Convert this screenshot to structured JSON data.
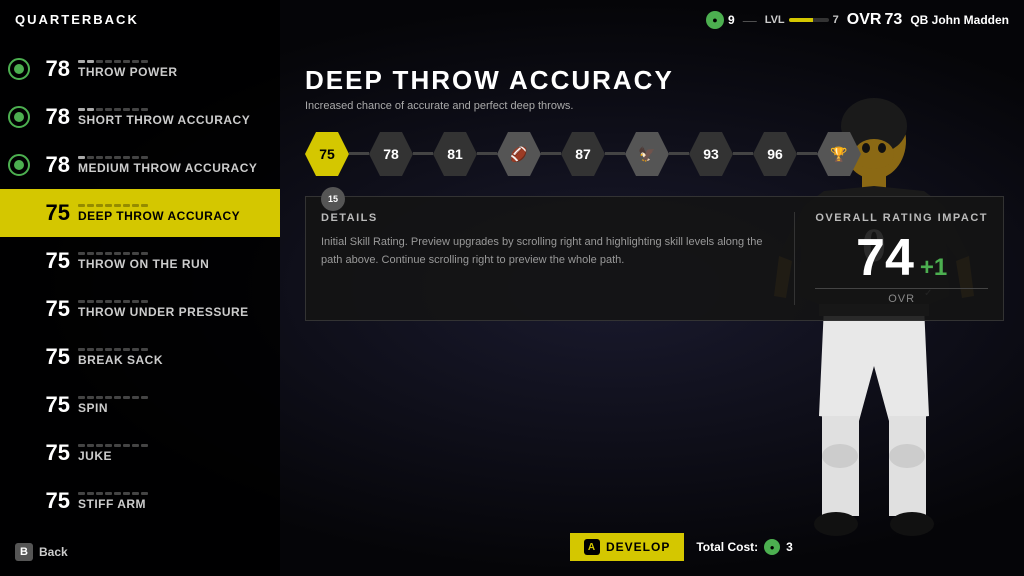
{
  "header": {
    "currency_amount": "9",
    "level_label": "LVL",
    "level_value": "7",
    "ovr_label": "OVR",
    "ovr_value": "73",
    "position_label": "QB",
    "player_name": "John Madden"
  },
  "sidebar": {
    "title": "QUARTERBACK",
    "skills": [
      {
        "id": "throw-power",
        "rating": "78",
        "name": "Throw Power",
        "dots": 8,
        "filled": 2,
        "active": false,
        "has_icon": true
      },
      {
        "id": "short-throw",
        "rating": "78",
        "name": "Short Throw Accuracy",
        "dots": 8,
        "filled": 2,
        "active": false,
        "has_icon": true
      },
      {
        "id": "medium-throw",
        "rating": "78",
        "name": "Medium Throw Accuracy",
        "dots": 8,
        "filled": 1,
        "active": false,
        "has_icon": true
      },
      {
        "id": "deep-throw",
        "rating": "75",
        "name": "Deep Throw Accuracy",
        "dots": 8,
        "filled": 0,
        "active": true,
        "has_icon": false
      },
      {
        "id": "throw-on-run",
        "rating": "75",
        "name": "Throw On The Run",
        "dots": 8,
        "filled": 0,
        "active": false,
        "has_icon": false
      },
      {
        "id": "throw-pressure",
        "rating": "75",
        "name": "Throw Under Pressure",
        "dots": 8,
        "filled": 0,
        "active": false,
        "has_icon": false
      },
      {
        "id": "break-sack",
        "rating": "75",
        "name": "Break Sack",
        "dots": 8,
        "filled": 0,
        "active": false,
        "has_icon": false
      },
      {
        "id": "spin",
        "rating": "75",
        "name": "Spin",
        "dots": 8,
        "filled": 0,
        "active": false,
        "has_icon": false
      },
      {
        "id": "juke",
        "rating": "75",
        "name": "Juke",
        "dots": 8,
        "filled": 0,
        "active": false,
        "has_icon": false
      },
      {
        "id": "stiff-arm",
        "rating": "75",
        "name": "Stiff Arm",
        "dots": 8,
        "filled": 0,
        "active": false,
        "has_icon": false
      }
    ]
  },
  "skill_detail": {
    "title": "DEEP THROW ACCURACY",
    "description": "Increased chance of accurate and perfect deep throws.",
    "upgrade_path": [
      {
        "type": "number",
        "value": "75",
        "current": true
      },
      {
        "type": "number",
        "value": "78"
      },
      {
        "type": "number",
        "value": "81"
      },
      {
        "type": "icon",
        "value": "🏈"
      },
      {
        "type": "number",
        "value": "87"
      },
      {
        "type": "icon",
        "value": "🦅"
      },
      {
        "type": "number",
        "value": "93"
      },
      {
        "type": "number",
        "value": "96"
      },
      {
        "type": "icon",
        "value": "🏆"
      }
    ],
    "details_label": "DETAILS",
    "details_text": "Initial Skill Rating. Preview upgrades by scrolling right and highlighting skill levels along the path above. Continue scrolling right to preview the whole path.",
    "ovr_impact_label": "OVERALL RATING IMPACT",
    "ovr_current": "74",
    "ovr_change": "+1",
    "ovr_sublabel": "OVR",
    "current_node_value": "15",
    "develop_label": "Develop",
    "develop_btn_icon": "A",
    "total_cost_label": "Total Cost:",
    "total_cost_amount": "3"
  },
  "footer": {
    "back_label": "Back",
    "back_icon": "B"
  },
  "player": {
    "jersey_number": "0"
  }
}
